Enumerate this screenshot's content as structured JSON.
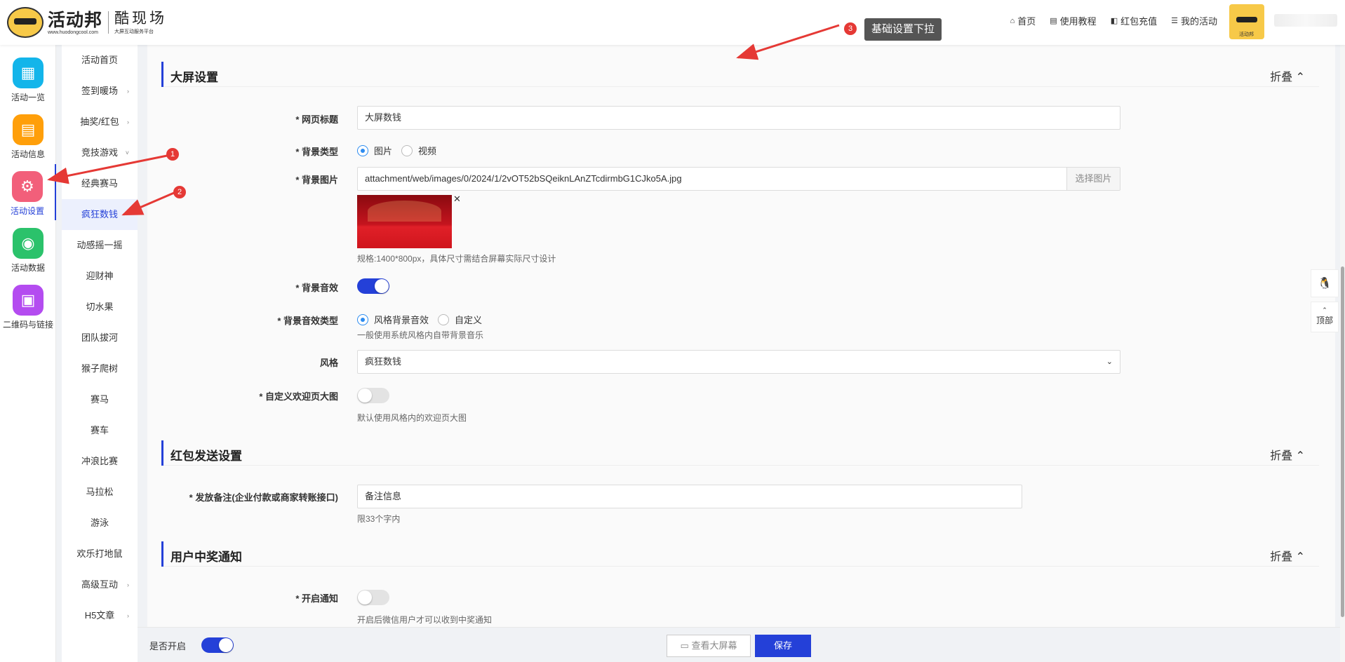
{
  "header": {
    "logo_main": "活动邦",
    "logo_sub": "www.huodongcool.com",
    "brand": "酷现场",
    "brand_sub": "大屏互动服务平台",
    "nav": [
      {
        "label": "首页",
        "icon": "home-icon"
      },
      {
        "label": "使用教程",
        "icon": "book-icon"
      },
      {
        "label": "红包充值",
        "icon": "wallet-icon"
      },
      {
        "label": "我的活动",
        "icon": "list-icon"
      }
    ],
    "avatar_label": "活动邦"
  },
  "sidebar_main": [
    {
      "label": "活动一览",
      "icon": "grid-icon",
      "color": "#13b5ea"
    },
    {
      "label": "活动信息",
      "icon": "document-icon",
      "color": "#ff9f0a"
    },
    {
      "label": "活动设置",
      "icon": "gear-icon",
      "color": "#f25f7a",
      "active": true
    },
    {
      "label": "活动数据",
      "icon": "database-icon",
      "color": "#2bc26b"
    },
    {
      "label": "二维码与链接",
      "icon": "qrcode-icon",
      "color": "#b44cf0"
    }
  ],
  "sidebar_sub": [
    {
      "label": "活动首页"
    },
    {
      "label": "签到暖场",
      "arrow": "›"
    },
    {
      "label": "抽奖/红包",
      "arrow": "›"
    },
    {
      "label": "竞技游戏",
      "arrow": "˅"
    },
    {
      "label": "经典赛马"
    },
    {
      "label": "疯狂数钱",
      "active": true
    },
    {
      "label": "动感摇一摇"
    },
    {
      "label": "迎财神"
    },
    {
      "label": "切水果"
    },
    {
      "label": "团队拔河"
    },
    {
      "label": "猴子爬树"
    },
    {
      "label": "赛马"
    },
    {
      "label": "赛车"
    },
    {
      "label": "冲浪比赛"
    },
    {
      "label": "马拉松"
    },
    {
      "label": "游泳"
    },
    {
      "label": "欢乐打地鼠"
    },
    {
      "label": "高级互动",
      "arrow": "›"
    },
    {
      "label": "H5文章",
      "arrow": "›"
    }
  ],
  "screen_settings": {
    "title": "大屏设置",
    "fold": "折叠 ⌃",
    "page_title_label": "* 网页标题",
    "page_title_value": "大屏数钱",
    "bg_type_label": "* 背景类型",
    "bg_type_options": [
      "图片",
      "视频"
    ],
    "bg_image_label": "* 背景图片",
    "bg_image_value": "attachment/web/images/0/2024/1/2vOT52bSQeiknLAnZTcdirmbG1CJko5A.jpg",
    "bg_image_button": "选择图片",
    "bg_image_hint": "规格:1400*800px，具体尺寸需结合屏幕实际尺寸设计",
    "bg_sound_label": "* 背景音效",
    "bg_sound_type_label": "* 背景音效类型",
    "bg_sound_type_options": [
      "风格背景音效",
      "自定义"
    ],
    "bg_sound_type_hint": "一般使用系统风格内自带背景音乐",
    "style_label": "风格",
    "style_value": "疯狂数钱",
    "welcome_label": "* 自定义欢迎页大图",
    "welcome_hint": "默认使用风格内的欢迎页大图"
  },
  "redpacket_settings": {
    "title": "红包发送设置",
    "fold": "折叠 ⌃",
    "remark_label": "* 发放备注(企业付款或商家转账接口)",
    "remark_value": "备注信息",
    "remark_hint": "限33个字内"
  },
  "winner_notice": {
    "title": "用户中奖通知",
    "fold": "折叠 ⌃",
    "notify_label": "* 开启通知",
    "notify_hint": "开启后微信用户才可以收到中奖通知"
  },
  "footer": {
    "enable_label": "是否开启",
    "preview_button": "查看大屏幕",
    "save_button": "保存"
  },
  "float": {
    "top_label": "顶部"
  },
  "annotations": {
    "tip3": "基础设置下拉",
    "badges": [
      "1",
      "2",
      "3"
    ]
  }
}
